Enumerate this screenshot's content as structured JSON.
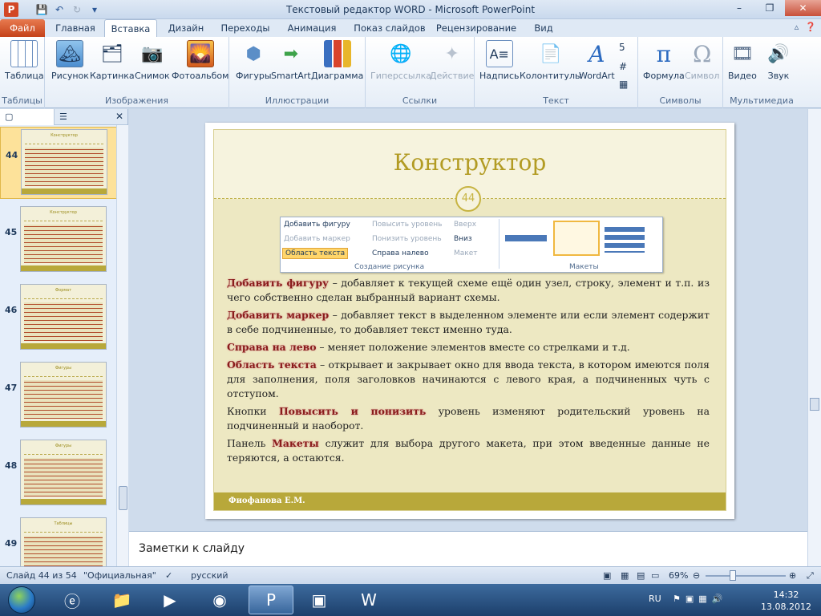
{
  "window": {
    "title": "Текстовый редактор WORD  -  Microsoft PowerPoint",
    "app_icon_letter": "P",
    "controls": [
      "–",
      "❐",
      "✕"
    ]
  },
  "tabs": {
    "file": "Файл",
    "items": [
      "Главная",
      "Вставка",
      "Дизайн",
      "Переходы",
      "Анимация",
      "Показ слайдов",
      "Рецензирование",
      "Вид"
    ],
    "active": "Вставка"
  },
  "ribbon": {
    "groups": {
      "tables": "Таблицы",
      "images": "Изображения",
      "illustrations": "Иллюстрации",
      "links": "Ссылки",
      "text": "Текст",
      "symbols": "Символы",
      "media": "Мультимедиа"
    },
    "buttons": {
      "table": "Таблица",
      "picture": "Рисунок",
      "clipart": "Картинка",
      "screenshot": "Снимок",
      "photoalbum": "Фотоальбом",
      "shapes": "Фигуры",
      "smartart": "SmartArt",
      "chart": "Диаграмма",
      "hyperlink": "Гиперссылка",
      "action": "Действие",
      "textbox": "Надпись",
      "headerfooter": "Колонтитулы",
      "wordart": "WordArt",
      "equation": "Формула",
      "symbol": "Символ",
      "video": "Видео",
      "audio": "Звук"
    }
  },
  "thumbnails": {
    "slides": [
      {
        "num": "44",
        "title": "Конструктор",
        "selected": true
      },
      {
        "num": "45",
        "title": "Конструктор",
        "selected": false
      },
      {
        "num": "46",
        "title": "Формат",
        "selected": false
      },
      {
        "num": "47",
        "title": "Фигуры",
        "selected": false
      },
      {
        "num": "48",
        "title": "Фигуры",
        "selected": false
      },
      {
        "num": "49",
        "title": "Таблицы",
        "selected": false
      }
    ]
  },
  "slide": {
    "title": "Конструктор",
    "number": "44",
    "footer": "Фиофанова Е.М.",
    "screenshot": {
      "add_shape": "Добавить фигуру",
      "add_bullet": "Добавить маркер",
      "text_pane": "Область текста",
      "promote": "Повысить уровень",
      "demote": "Понизить уровень",
      "rtl": "Справа налево",
      "up": "Вверх",
      "down": "Вниз",
      "layout": "Макет",
      "group_create": "Создание рисунка",
      "group_layouts": "Макеты"
    },
    "paragraphs": [
      {
        "kw": "Добавить фигуру",
        "text": " – добавляет к текущей схеме ещё один узел, строку, элемент и т.п. из чего собственно сделан выбранный вариант  схемы."
      },
      {
        "kw": "Добавить маркер",
        "text": " – добавляет текст в выделенном элементе или если элемент содержит в себе подчиненные, то добавляет текст именно туда."
      },
      {
        "kw": "Справа на лево",
        "text": " – меняет положение элементов вместе со стрелками и т.д."
      },
      {
        "kw": "Область текста",
        "text": " – открывает и закрывает окно для ввода текста, в котором имеются поля для заполнения, поля заголовков начинаются с левого края, а подчиненных чуть с отступом."
      }
    ],
    "para5": {
      "pre": "Кнопки ",
      "kw": "Повысить и понизить",
      "post": " уровень изменяют родительский уровень на подчиненный и наоборот."
    },
    "para6": {
      "pre": "Панель ",
      "kw": "Макеты",
      "post": " служит для выбора другого макета, при этом введенные данные не теряются, а остаются."
    }
  },
  "notes": {
    "placeholder": "Заметки к слайду"
  },
  "status": {
    "slide": "Слайд 44 из 54",
    "theme": "\"Официальная\"",
    "language": "русский",
    "zoom": "69%",
    "zoom_fraction": 0.69
  },
  "taskbar": {
    "lang": "RU",
    "time": "14:32",
    "date": "13.08.2012"
  }
}
